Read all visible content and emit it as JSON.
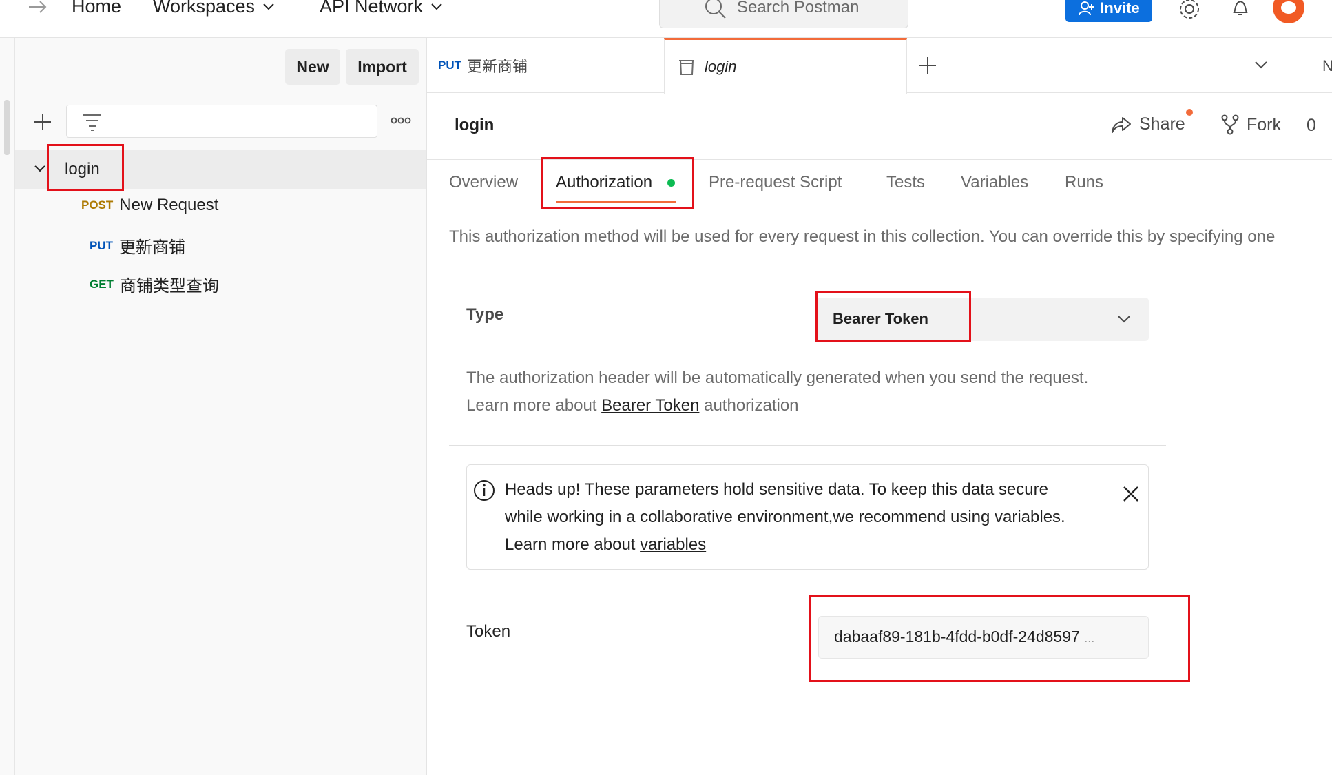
{
  "topbar": {
    "home": "Home",
    "workspaces": "Workspaces",
    "api_network": "API Network",
    "search_placeholder": "Search Postman",
    "invite": "Invite"
  },
  "sidebar": {
    "new_label": "New",
    "import_label": "Import",
    "collection_name": "login",
    "requests": [
      {
        "method": "POST",
        "name": "New Request",
        "color": "#ad7a03"
      },
      {
        "method": "PUT",
        "name": "更新商铺",
        "color": "#0053b8"
      },
      {
        "method": "GET",
        "name": "商铺类型查询",
        "color": "#007f31"
      }
    ]
  },
  "tabs": {
    "tab1_method": "PUT",
    "tab1_name": "更新商铺",
    "tab2_name": "login",
    "partial_right": "N"
  },
  "header": {
    "title": "login",
    "share": "Share",
    "fork": "Fork",
    "fork_count": "0"
  },
  "subtabs": [
    "Overview",
    "Authorization",
    "Pre-request Script",
    "Tests",
    "Variables",
    "Runs"
  ],
  "auth": {
    "intro": "This authorization method will be used for every request in this collection. You can override this by specifying one",
    "type_label": "Type",
    "type_value": "Bearer Token",
    "help_line1": "The authorization header will be automatically generated when you send the request.",
    "help_prefix": "Learn more about ",
    "help_link": "Bearer Token",
    "help_suffix": " authorization",
    "alert_line1": "Heads up! These parameters hold sensitive data. To keep this data secure",
    "alert_line2": "while working in a collaborative environment,we recommend using variables.",
    "alert_prefix": "Learn more about ",
    "alert_link": "variables",
    "token_label": "Token",
    "token_value": "dabaaf89-181b-4fdd-b0df-24d8597",
    "token_ellipsis": "..."
  },
  "colors": {
    "accent": "#f26b3a",
    "invite_blue": "#0c6fde",
    "highlight_red": "#e3111a",
    "status_green": "#0cbb52"
  }
}
